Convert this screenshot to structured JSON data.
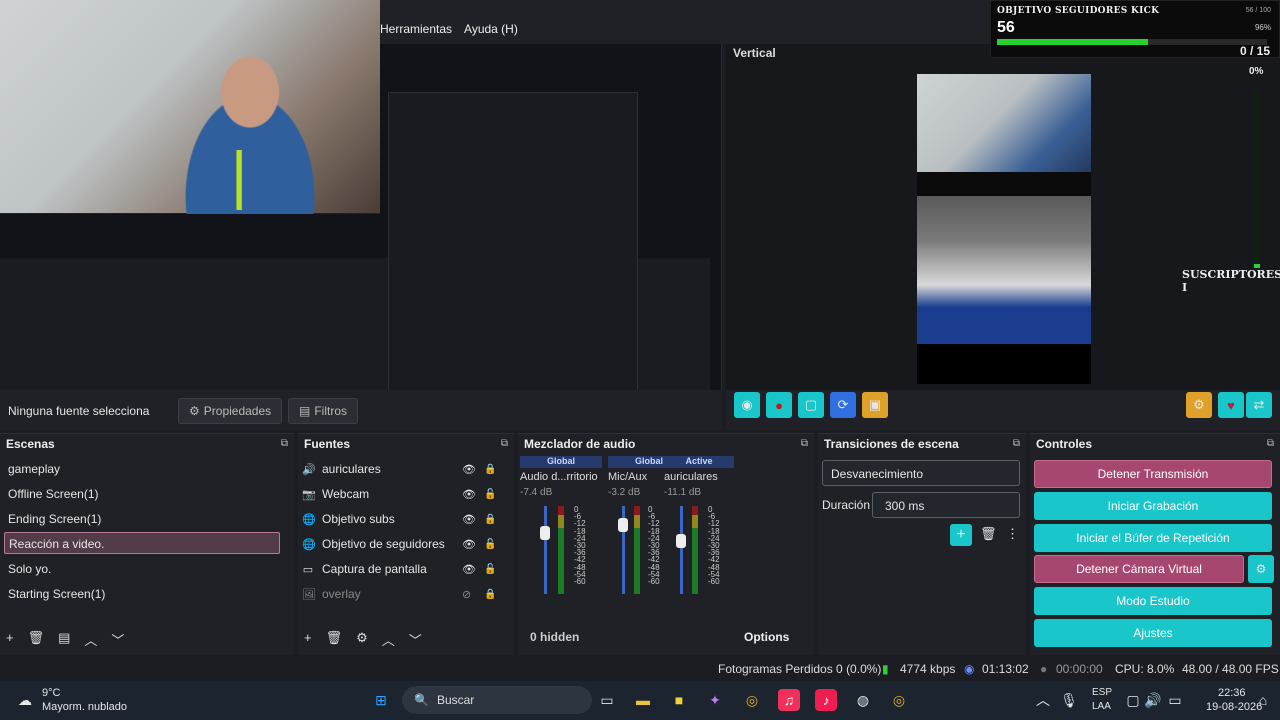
{
  "menu": {
    "items": [
      "Herramientas",
      "Ayuda (H)"
    ]
  },
  "kick_overlay": {
    "title": "OBJETIVO SEGUIDORES KICK",
    "count": "56",
    "ratio": "56 / 100",
    "percent": "96%",
    "fill": 0.56
  },
  "vertical": {
    "title": "Vertical",
    "counter": "0 / 15",
    "pct": "0%",
    "suscriptores": "SUSCRIPTORES I"
  },
  "source_bar": {
    "status": "Ninguna fuente selecciona",
    "properties": "Propiedades",
    "filters": "Filtros"
  },
  "scenes": {
    "title": "Escenas",
    "items": [
      "gameplay",
      "Offline Screen(1)",
      "Ending Screen(1)",
      "Reacción a video.",
      "Solo yo.",
      "Starting Screen(1)"
    ],
    "selected": 3
  },
  "sources": {
    "title": "Fuentes",
    "items": [
      {
        "icon": "🔊",
        "label": "auriculares"
      },
      {
        "icon": "📷",
        "label": "Webcam"
      },
      {
        "icon": "🌐",
        "label": "Objetivo subs"
      },
      {
        "icon": "🌐",
        "label": "Objetivo de seguidores"
      },
      {
        "icon": "▭",
        "label": "Captura de pantalla"
      },
      {
        "icon": "🖼",
        "label": "overlay"
      }
    ]
  },
  "mixer": {
    "title": "Mezclador de audio",
    "hidden": "0 hidden",
    "options": "Options",
    "channels": [
      {
        "header": "Global",
        "name": "Audio d...rritorio",
        "db": "-7.4 dB"
      },
      {
        "header": "Global",
        "name": "Mic/Aux",
        "db": "-3.2 dB"
      },
      {
        "header": "Active",
        "name": "auriculares",
        "db": "-11.1 dB"
      }
    ],
    "scale": [
      "0",
      "-6",
      "-12",
      "-18",
      "-24",
      "-30",
      "-36",
      "-42",
      "-48",
      "-54",
      "-60"
    ]
  },
  "transitions": {
    "title": "Transiciones de escena",
    "selected": "Desvanecimiento",
    "duration_label": "Duración",
    "duration_value": "300 ms"
  },
  "controls": {
    "title": "Controles",
    "stop_stream": "Detener Transmisión",
    "start_record": "Iniciar Grabación",
    "replay_buffer": "Iniciar el Búfer de Repetición",
    "stop_vcam": "Detener Cámara Virtual",
    "studio_mode": "Modo Estudio",
    "settings": "Ajustes"
  },
  "status": {
    "dropped": "Fotogramas Perdidos 0 (0.0%)",
    "kbps": "4774 kbps",
    "stream_time": "01:13:02",
    "rec_time": "00:00:00",
    "cpu": "CPU: 8.0%",
    "fps": "48.00 / 48.00 FPS"
  },
  "taskbar": {
    "temp": "9°C",
    "weather": "Mayorm. nublado",
    "search": "Buscar",
    "lang1": "ESP",
    "lang2": "LAA",
    "time": "22:36",
    "date": "19-08-2026"
  },
  "colors": {
    "teal": "#19c6c9",
    "pink": "#a6476f",
    "accent": "#27d130"
  }
}
